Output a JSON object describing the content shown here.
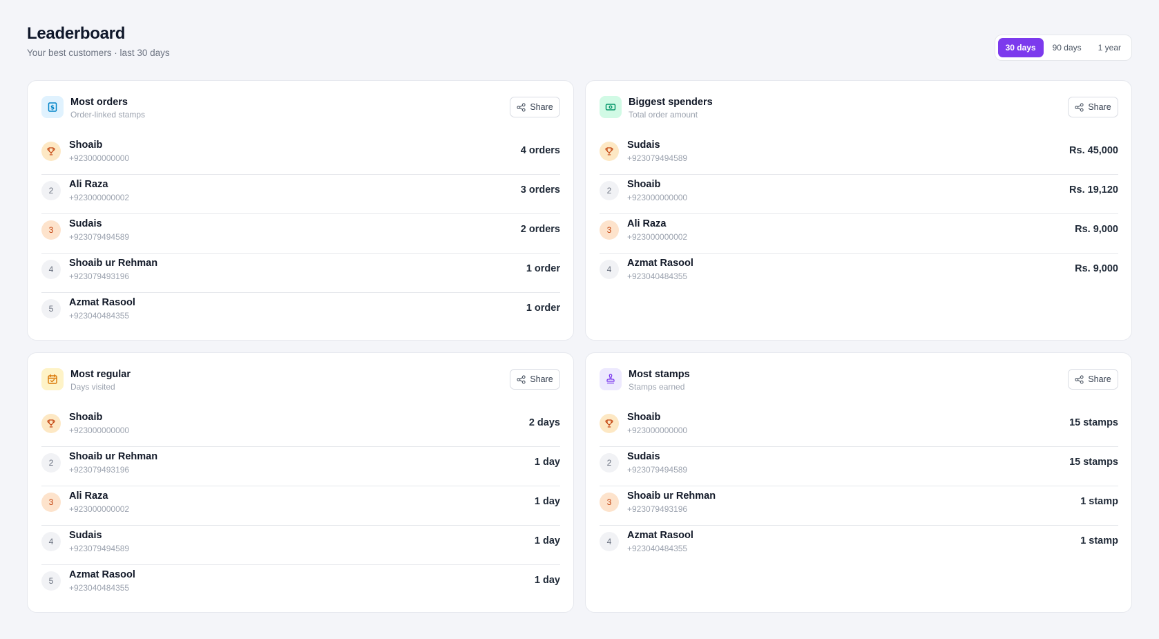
{
  "header": {
    "title": "Leaderboard",
    "subtitle": "Your best customers · last 30 days"
  },
  "ranges": [
    {
      "label": "30 days",
      "active": true
    },
    {
      "label": "90 days",
      "active": false
    },
    {
      "label": "1 year",
      "active": false
    }
  ],
  "share_label": "Share",
  "cards": [
    {
      "title": "Most orders",
      "subtitle": "Order-linked stamps",
      "icon": "dollar-receipt-icon",
      "accent": "#0284c7",
      "rows": [
        {
          "rank": "1",
          "name": "Shoaib",
          "phone": "+923000000000",
          "value": "4 orders"
        },
        {
          "rank": "2",
          "name": "Ali Raza",
          "phone": "+923000000002",
          "value": "3 orders"
        },
        {
          "rank": "3",
          "name": "Sudais",
          "phone": "+923079494589",
          "value": "2 orders"
        },
        {
          "rank": "4",
          "name": "Shoaib ur Rehman",
          "phone": "+923079493196",
          "value": "1 order"
        },
        {
          "rank": "5",
          "name": "Azmat Rasool",
          "phone": "+923040484355",
          "value": "1 order"
        }
      ]
    },
    {
      "title": "Biggest spenders",
      "subtitle": "Total order amount",
      "icon": "banknote-icon",
      "accent": "#059669",
      "rows": [
        {
          "rank": "1",
          "name": "Sudais",
          "phone": "+923079494589",
          "value": "Rs. 45,000"
        },
        {
          "rank": "2",
          "name": "Shoaib",
          "phone": "+923000000000",
          "value": "Rs. 19,120"
        },
        {
          "rank": "3",
          "name": "Ali Raza",
          "phone": "+923000000002",
          "value": "Rs. 9,000"
        },
        {
          "rank": "4",
          "name": "Azmat Rasool",
          "phone": "+923040484355",
          "value": "Rs. 9,000"
        }
      ]
    },
    {
      "title": "Most regular",
      "subtitle": "Days visited",
      "icon": "calendar-check-icon",
      "accent": "#d97706",
      "rows": [
        {
          "rank": "1",
          "name": "Shoaib",
          "phone": "+923000000000",
          "value": "2 days"
        },
        {
          "rank": "2",
          "name": "Shoaib ur Rehman",
          "phone": "+923079493196",
          "value": "1 day"
        },
        {
          "rank": "3",
          "name": "Ali Raza",
          "phone": "+923000000002",
          "value": "1 day"
        },
        {
          "rank": "4",
          "name": "Sudais",
          "phone": "+923079494589",
          "value": "1 day"
        },
        {
          "rank": "5",
          "name": "Azmat Rasool",
          "phone": "+923040484355",
          "value": "1 day"
        }
      ]
    },
    {
      "title": "Most stamps",
      "subtitle": "Stamps earned",
      "icon": "stamp-icon",
      "accent": "#7c3aed",
      "rows": [
        {
          "rank": "1",
          "name": "Shoaib",
          "phone": "+923000000000",
          "value": "15 stamps"
        },
        {
          "rank": "2",
          "name": "Sudais",
          "phone": "+923079494589",
          "value": "15 stamps"
        },
        {
          "rank": "3",
          "name": "Shoaib ur Rehman",
          "phone": "+923079493196",
          "value": "1 stamp"
        },
        {
          "rank": "4",
          "name": "Azmat Rasool",
          "phone": "+923040484355",
          "value": "1 stamp"
        }
      ]
    }
  ]
}
